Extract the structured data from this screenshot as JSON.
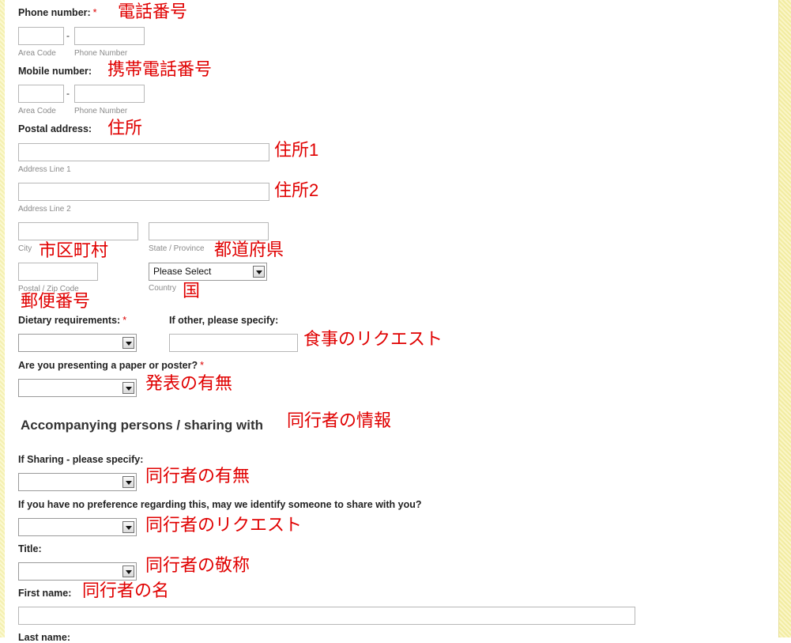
{
  "phone": {
    "label": "Phone number:",
    "required": "*",
    "annotation": "電話番号",
    "dash": "-",
    "area_code_caption": "Area Code",
    "number_caption": "Phone Number"
  },
  "mobile": {
    "label": "Mobile number:",
    "annotation": "携帯電話番号",
    "dash": "-",
    "area_code_caption": "Area Code",
    "number_caption": "Phone Number"
  },
  "postal": {
    "label": "Postal address:",
    "annotation": "住所",
    "line1_caption": "Address Line 1",
    "line1_annotation": "住所1",
    "line2_caption": "Address Line 2",
    "line2_annotation": "住所2",
    "city_caption": "City",
    "city_annotation": "市区町村",
    "state_caption": "State / Province",
    "state_annotation": "都道府県",
    "zip_caption": "Postal / Zip Code",
    "zip_annotation": "郵便番号",
    "country_caption": "Country",
    "country_annotation": "国",
    "country_value": "Please Select"
  },
  "dietary": {
    "label": "Dietary requirements:",
    "required": "*",
    "other_label": "If other, please specify:",
    "annotation": "食事のリクエスト"
  },
  "presenting": {
    "label": "Are you presenting a paper or poster?",
    "required": "*",
    "annotation": "発表の有無"
  },
  "accompanying": {
    "heading": "Accompanying persons / sharing with",
    "annotation": "同行者の情報"
  },
  "sharing": {
    "label": "If Sharing - please specify:",
    "annotation": "同行者の有無"
  },
  "preference": {
    "label": "If you have no preference regarding this, may we identify someone to share with you?",
    "annotation": "同行者のリクエスト"
  },
  "title": {
    "label": "Title:",
    "annotation": "同行者の敬称"
  },
  "first_name": {
    "label": "First name:",
    "annotation": "同行者の名"
  },
  "last_name": {
    "label": "Last name:"
  }
}
